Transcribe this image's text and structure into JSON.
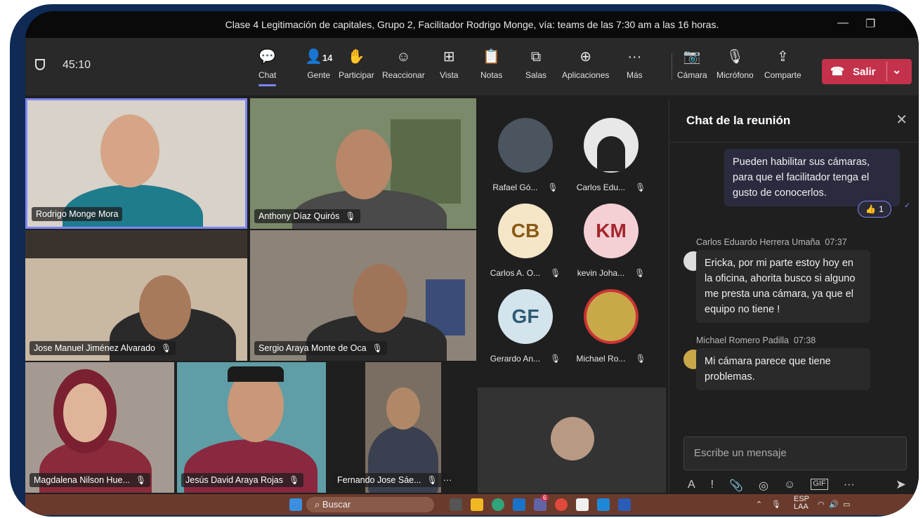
{
  "window": {
    "title": "Clase 4 Legitimación de capitales,  Grupo 2, Facilitador Rodrigo Monge, vía: teams de las 7:30 am a las 16 horas."
  },
  "toolbar": {
    "timer": "45:10",
    "people_count": "14",
    "buttons": [
      {
        "label": "Chat",
        "icon": "chat-icon"
      },
      {
        "label": "Gente",
        "icon": "people-icon"
      },
      {
        "label": "Participar",
        "icon": "raise-hand-icon"
      },
      {
        "label": "Reaccionar",
        "icon": "smiley-icon"
      },
      {
        "label": "Vista",
        "icon": "grid-view-icon"
      },
      {
        "label": "Notas",
        "icon": "notes-icon"
      },
      {
        "label": "Salas",
        "icon": "rooms-icon"
      },
      {
        "label": "Aplicaciones",
        "icon": "apps-plus-icon"
      },
      {
        "label": "Más",
        "icon": "more-icon"
      },
      {
        "label": "Cámara",
        "icon": "camera-off-icon"
      },
      {
        "label": "Micrófono",
        "icon": "mic-off-icon"
      },
      {
        "label": "Comparte",
        "icon": "share-icon"
      }
    ],
    "leave_label": "Salir"
  },
  "video_tiles": [
    {
      "name": "Rodrigo Monge Mora"
    },
    {
      "name": "Anthony Díaz Quirós"
    },
    {
      "name": "Jose Manuel Jiménez Alvarado"
    },
    {
      "name": "Sergio Araya Monte de Oca"
    },
    {
      "name": "Magdalena Nilson Hue..."
    },
    {
      "name": "Jesús David Araya Rojas"
    },
    {
      "name": "Fernando Jose Sáe..."
    }
  ],
  "roster": [
    {
      "name": "Rafael Gó...",
      "initials": ""
    },
    {
      "name": "Carlos Edu...",
      "initials": ""
    },
    {
      "name": "Carlos A. O...",
      "initials": "CB"
    },
    {
      "name": "kevin Joha...",
      "initials": "KM"
    },
    {
      "name": "Gerardo An...",
      "initials": "GF"
    },
    {
      "name": "Michael Ro...",
      "initials": ""
    }
  ],
  "chat": {
    "title": "Chat de la reunión",
    "messages": [
      {
        "author": "",
        "time": "",
        "text": "Pueden habilitar sus cámaras, para que el facilitador tenga el gusto de conocerlos.",
        "reaction_count": "1"
      },
      {
        "author": "Carlos Eduardo Herrera Umaña",
        "time": "07:37",
        "text": "Ericka, por mi parte estoy hoy en la oficina, ahorita busco si alguno me presta una cámara, ya que el equipo no tiene !"
      },
      {
        "author": "Michael Romero Padilla",
        "time": "07:38",
        "text": "Mi cámara parece que tiene problemas."
      }
    ],
    "compose_placeholder": "Escribe un mensaje"
  },
  "taskbar": {
    "search_label": "Buscar",
    "language": "ESP",
    "layout": "LAA",
    "teams_badge": "6"
  },
  "colors": {
    "accent": "#7f85f5",
    "leave": "#c4314b",
    "background": "#1f1f1f"
  }
}
